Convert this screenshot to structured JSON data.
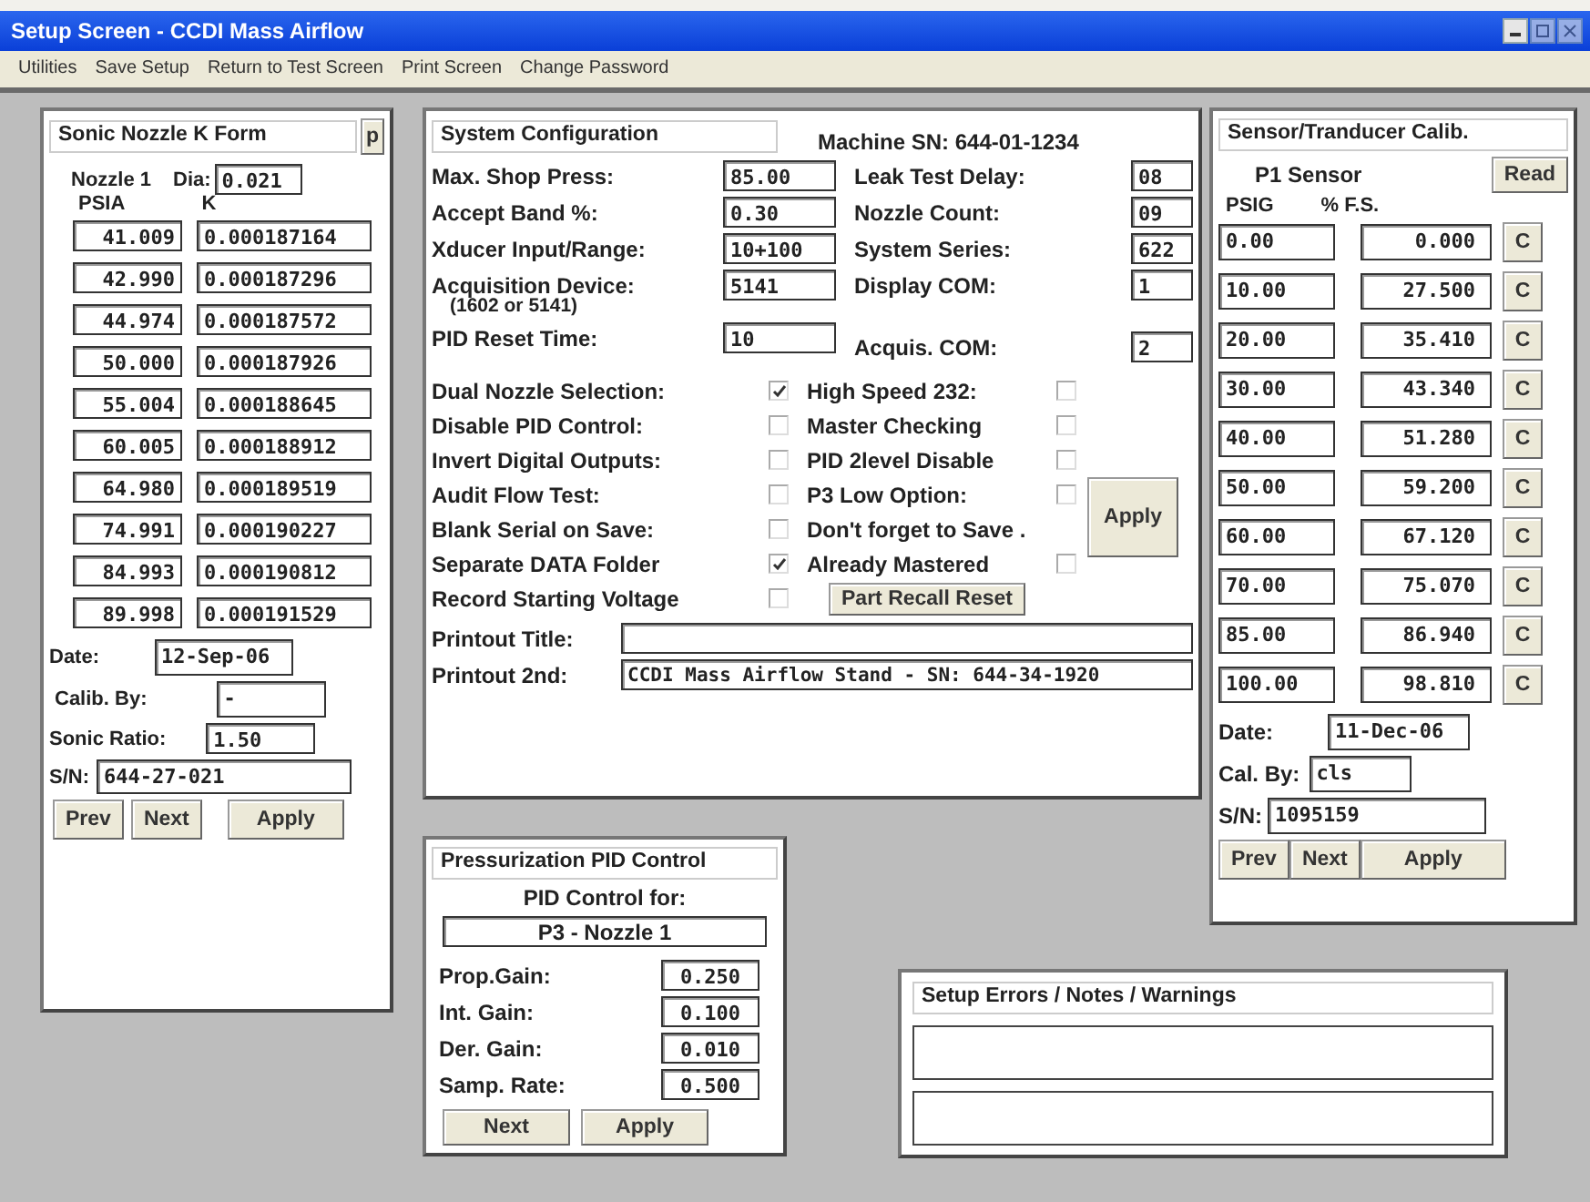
{
  "window": {
    "title": "Setup Screen - CCDI Mass Airflow"
  },
  "menu": [
    "Utilities",
    "Save Setup",
    "Return to Test Screen",
    "Print Screen",
    "Change Password"
  ],
  "sonic_nozzle": {
    "title": "Sonic Nozzle K Form",
    "side_button": "p",
    "nozzle_label": "Nozzle 1",
    "dia_label": "Dia:",
    "dia": "0.021",
    "columns": [
      "PSIA",
      "K"
    ],
    "rows": [
      {
        "psia": "41.009",
        "k": "0.000187164"
      },
      {
        "psia": "42.990",
        "k": "0.000187296"
      },
      {
        "psia": "44.974",
        "k": "0.000187572"
      },
      {
        "psia": "50.000",
        "k": "0.000187926"
      },
      {
        "psia": "55.004",
        "k": "0.000188645"
      },
      {
        "psia": "60.005",
        "k": "0.000188912"
      },
      {
        "psia": "64.980",
        "k": "0.000189519"
      },
      {
        "psia": "74.991",
        "k": "0.000190227"
      },
      {
        "psia": "84.993",
        "k": "0.000190812"
      },
      {
        "psia": "89.998",
        "k": "0.000191529"
      }
    ],
    "date_label": "Date:",
    "date": "12-Sep-06",
    "calib_by_label": "Calib. By:",
    "calib_by": "-",
    "sonic_ratio_label": "Sonic Ratio:",
    "sonic_ratio": "1.50",
    "sn_label": "S/N:",
    "sn": "644-27-021",
    "buttons": [
      "Prev",
      "Next",
      "Apply"
    ]
  },
  "system_config": {
    "title": "System Configuration",
    "machine_sn": "Machine SN: 644-01-1234",
    "left_fields": [
      {
        "label": "Max. Shop Press:",
        "value": "85.00"
      },
      {
        "label": "Accept Band %:",
        "value": "0.30"
      },
      {
        "label": "Xducer Input/Range:",
        "value": "10+100"
      },
      {
        "label": "Acquisition Device:",
        "sublabel": "(1602 or 5141)",
        "value": "5141"
      },
      {
        "label": "PID Reset Time:",
        "value": "10"
      }
    ],
    "right_fields": [
      {
        "label": "Leak Test Delay:",
        "value": "08"
      },
      {
        "label": "Nozzle Count:",
        "value": "09"
      },
      {
        "label": "System Series:",
        "value": "622"
      },
      {
        "label": "Display COM:",
        "value": "1"
      },
      {
        "label": "Acquis. COM:",
        "value": "2"
      }
    ],
    "left_options": [
      {
        "label": "Dual Nozzle Selection:",
        "checked": true
      },
      {
        "label": "Disable PID Control:",
        "checked": false
      },
      {
        "label": "Invert Digital Outputs:",
        "checked": false
      },
      {
        "label": "Audit Flow Test:",
        "checked": false
      },
      {
        "label": "Blank Serial on Save:",
        "checked": false
      },
      {
        "label": "Separate DATA Folder",
        "checked": true
      },
      {
        "label": "Record Starting Voltage",
        "checked": false
      }
    ],
    "right_options": [
      {
        "kind": "checkbox",
        "label": "High Speed 232:",
        "checked": false
      },
      {
        "kind": "checkbox",
        "label": "Master Checking",
        "checked": false
      },
      {
        "kind": "checkbox",
        "label": "PID 2level Disable",
        "checked": false
      },
      {
        "kind": "checkbox",
        "label": "P3 Low Option:",
        "checked": false
      },
      {
        "kind": "note",
        "label": "Don't forget to Save ."
      },
      {
        "kind": "checkbox",
        "label": "Already Mastered",
        "checked": false
      },
      {
        "kind": "button",
        "label": "Part Recall Reset"
      }
    ],
    "apply_button": "Apply",
    "printout_title_label": "Printout Title:",
    "printout_2nd_label": "Printout 2nd:",
    "printout_2nd": "CCDI Mass Airflow Stand - SN: 644-34-1920"
  },
  "sensor_calib": {
    "title": "Sensor/Tranducer Calib.",
    "sensor_label": "P1 Sensor",
    "read_button": "Read",
    "columns": [
      "PSIG",
      "% F.S."
    ],
    "rows": [
      {
        "psig": "0.00",
        "fs": "0.000",
        "button": "C"
      },
      {
        "psig": "10.00",
        "fs": "27.500",
        "button": "C"
      },
      {
        "psig": "20.00",
        "fs": "35.410",
        "button": "C"
      },
      {
        "psig": "30.00",
        "fs": "43.340",
        "button": "C"
      },
      {
        "psig": "40.00",
        "fs": "51.280",
        "button": "C"
      },
      {
        "psig": "50.00",
        "fs": "59.200",
        "button": "C"
      },
      {
        "psig": "60.00",
        "fs": "67.120",
        "button": "C"
      },
      {
        "psig": "70.00",
        "fs": "75.070",
        "button": "C"
      },
      {
        "psig": "85.00",
        "fs": "86.940",
        "button": "C"
      },
      {
        "psig": "100.00",
        "fs": "98.810",
        "button": "C"
      }
    ],
    "date_label": "Date:",
    "date": "11-Dec-06",
    "cal_by_label": "Cal. By:",
    "cal_by": "cls",
    "sn_label": "S/N:",
    "sn": "1095159",
    "buttons": [
      "Prev",
      "Next",
      "Apply"
    ]
  },
  "pid_control": {
    "title": "Pressurization PID Control",
    "for_label": "PID Control for:",
    "for_value": "P3 - Nozzle 1",
    "fields": [
      {
        "label": "Prop.Gain:",
        "value": "0.250"
      },
      {
        "label": "Int. Gain:",
        "value": "0.100"
      },
      {
        "label": "Der. Gain:",
        "value": "0.010"
      },
      {
        "label": "Samp. Rate:",
        "value": "0.500"
      }
    ],
    "buttons": [
      "Next",
      "Apply"
    ]
  },
  "notes": {
    "title": "Setup Errors / Notes / Warnings"
  }
}
